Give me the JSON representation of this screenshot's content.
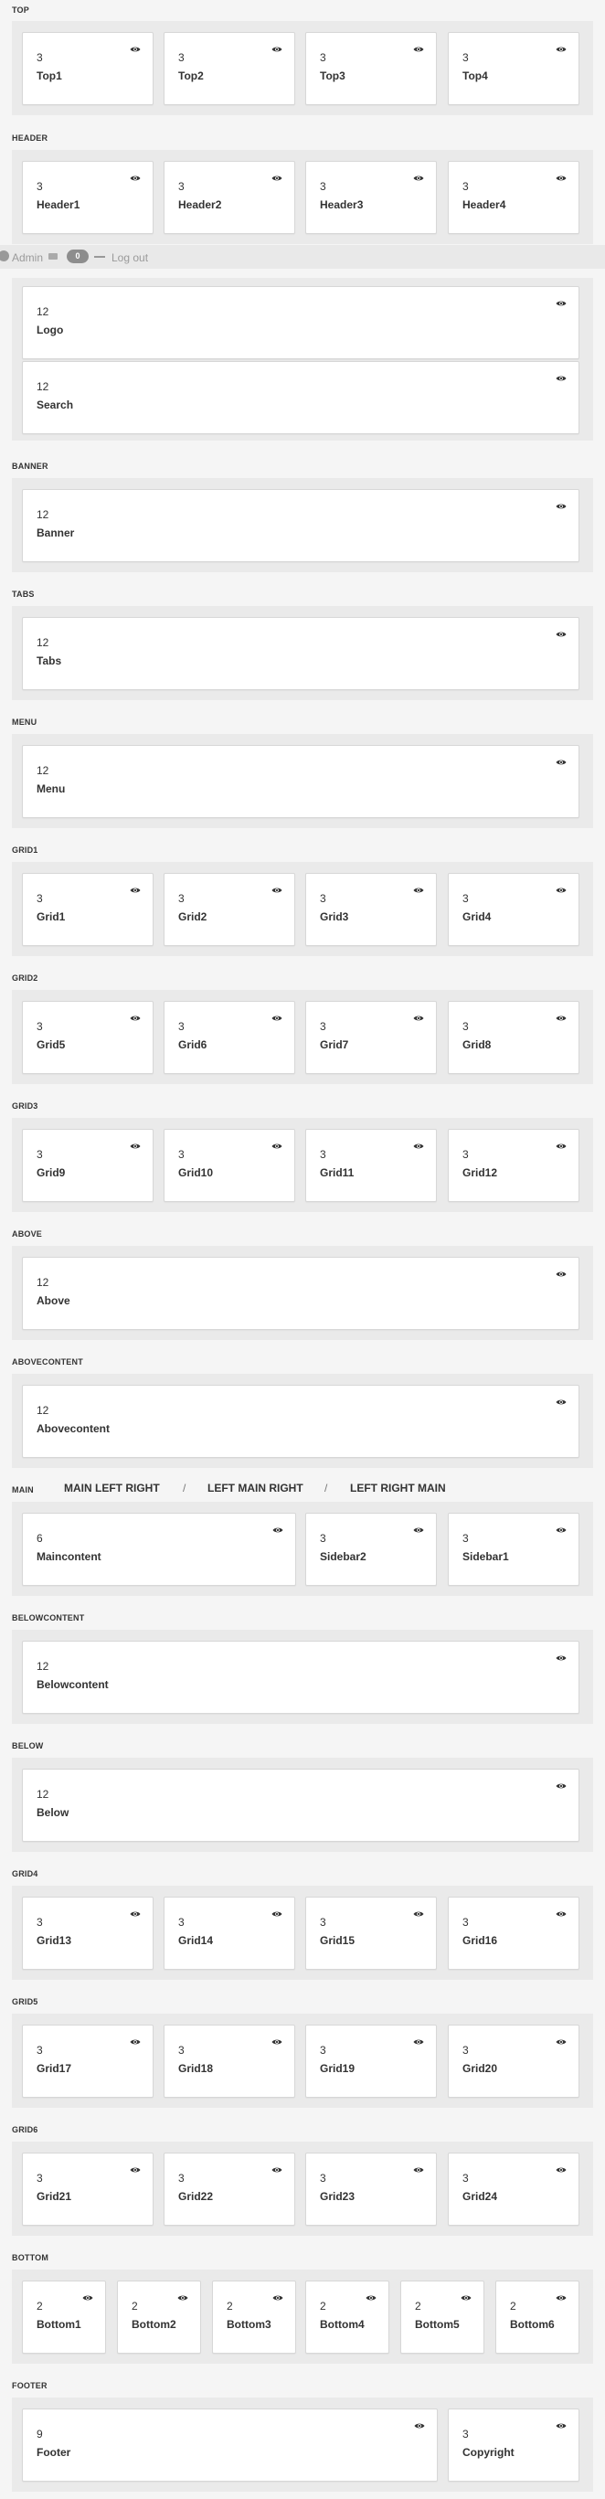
{
  "sections": {
    "top": {
      "title": "TOP",
      "cards": [
        {
          "num": "3",
          "label": "Top1"
        },
        {
          "num": "3",
          "label": "Top2"
        },
        {
          "num": "3",
          "label": "Top3"
        },
        {
          "num": "3",
          "label": "Top4"
        }
      ]
    },
    "header": {
      "title": "HEADER",
      "cards": [
        {
          "num": "3",
          "label": "Header1"
        },
        {
          "num": "3",
          "label": "Header2"
        },
        {
          "num": "3",
          "label": "Header3"
        },
        {
          "num": "3",
          "label": "Header4"
        }
      ]
    },
    "navigation": {
      "cards": [
        {
          "num": "12",
          "label": "Logo"
        },
        {
          "num": "12",
          "label": "Search"
        }
      ]
    },
    "banner": {
      "title": "BANNER",
      "cards": [
        {
          "num": "12",
          "label": "Banner"
        }
      ]
    },
    "tabs": {
      "title": "TABS",
      "cards": [
        {
          "num": "12",
          "label": "Tabs"
        }
      ]
    },
    "menu": {
      "title": "MENU",
      "cards": [
        {
          "num": "12",
          "label": "Menu"
        }
      ]
    },
    "grid1": {
      "title": "GRID1",
      "cards": [
        {
          "num": "3",
          "label": "Grid1"
        },
        {
          "num": "3",
          "label": "Grid2"
        },
        {
          "num": "3",
          "label": "Grid3"
        },
        {
          "num": "3",
          "label": "Grid4"
        }
      ]
    },
    "grid2": {
      "title": "GRID2",
      "cards": [
        {
          "num": "3",
          "label": "Grid5"
        },
        {
          "num": "3",
          "label": "Grid6"
        },
        {
          "num": "3",
          "label": "Grid7"
        },
        {
          "num": "3",
          "label": "Grid8"
        }
      ]
    },
    "grid3": {
      "title": "GRID3",
      "cards": [
        {
          "num": "3",
          "label": "Grid9"
        },
        {
          "num": "3",
          "label": "Grid10"
        },
        {
          "num": "3",
          "label": "Grid11"
        },
        {
          "num": "3",
          "label": "Grid12"
        }
      ]
    },
    "above": {
      "title": "ABOVE",
      "cards": [
        {
          "num": "12",
          "label": "Above"
        }
      ]
    },
    "abovecontent": {
      "title": "ABOVECONTENT",
      "cards": [
        {
          "num": "12",
          "label": "Abovecontent"
        }
      ]
    },
    "main": {
      "title": "MAIN",
      "layout_options": [
        "MAIN LEFT RIGHT",
        "LEFT MAIN RIGHT",
        "LEFT RIGHT MAIN"
      ],
      "separator": "/",
      "cards": [
        {
          "num": "6",
          "label": "Maincontent"
        },
        {
          "num": "3",
          "label": "Sidebar2"
        },
        {
          "num": "3",
          "label": "Sidebar1"
        }
      ]
    },
    "belowcontent": {
      "title": "BELOWCONTENT",
      "cards": [
        {
          "num": "12",
          "label": "Belowcontent"
        }
      ]
    },
    "below": {
      "title": "BELOW",
      "cards": [
        {
          "num": "12",
          "label": "Below"
        }
      ]
    },
    "grid4": {
      "title": "GRID4",
      "cards": [
        {
          "num": "3",
          "label": "Grid13"
        },
        {
          "num": "3",
          "label": "Grid14"
        },
        {
          "num": "3",
          "label": "Grid15"
        },
        {
          "num": "3",
          "label": "Grid16"
        }
      ]
    },
    "grid5": {
      "title": "GRID5",
      "cards": [
        {
          "num": "3",
          "label": "Grid17"
        },
        {
          "num": "3",
          "label": "Grid18"
        },
        {
          "num": "3",
          "label": "Grid19"
        },
        {
          "num": "3",
          "label": "Grid20"
        }
      ]
    },
    "grid6": {
      "title": "GRID6",
      "cards": [
        {
          "num": "3",
          "label": "Grid21"
        },
        {
          "num": "3",
          "label": "Grid22"
        },
        {
          "num": "3",
          "label": "Grid23"
        },
        {
          "num": "3",
          "label": "Grid24"
        }
      ]
    },
    "bottom": {
      "title": "BOTTOM",
      "cards": [
        {
          "num": "2",
          "label": "Bottom1"
        },
        {
          "num": "2",
          "label": "Bottom2"
        },
        {
          "num": "2",
          "label": "Bottom3"
        },
        {
          "num": "2",
          "label": "Bottom4"
        },
        {
          "num": "2",
          "label": "Bottom5"
        },
        {
          "num": "2",
          "label": "Bottom6"
        }
      ]
    },
    "footer": {
      "title": "FOOTER",
      "cards": [
        {
          "num": "9",
          "label": "Footer"
        },
        {
          "num": "3",
          "label": "Copyright"
        }
      ]
    }
  },
  "adminbar": {
    "admin_label": "Admin",
    "count": "0",
    "logout_label": "Log out"
  },
  "icons": {
    "visibility": "eye-icon",
    "mail": "mail-icon",
    "avatar": "avatar"
  },
  "colors": {
    "page_bg": "#f5f5f5",
    "row_bg": "#eaeaea",
    "card_bg": "#ffffff",
    "pill": "#8d8d8d"
  }
}
